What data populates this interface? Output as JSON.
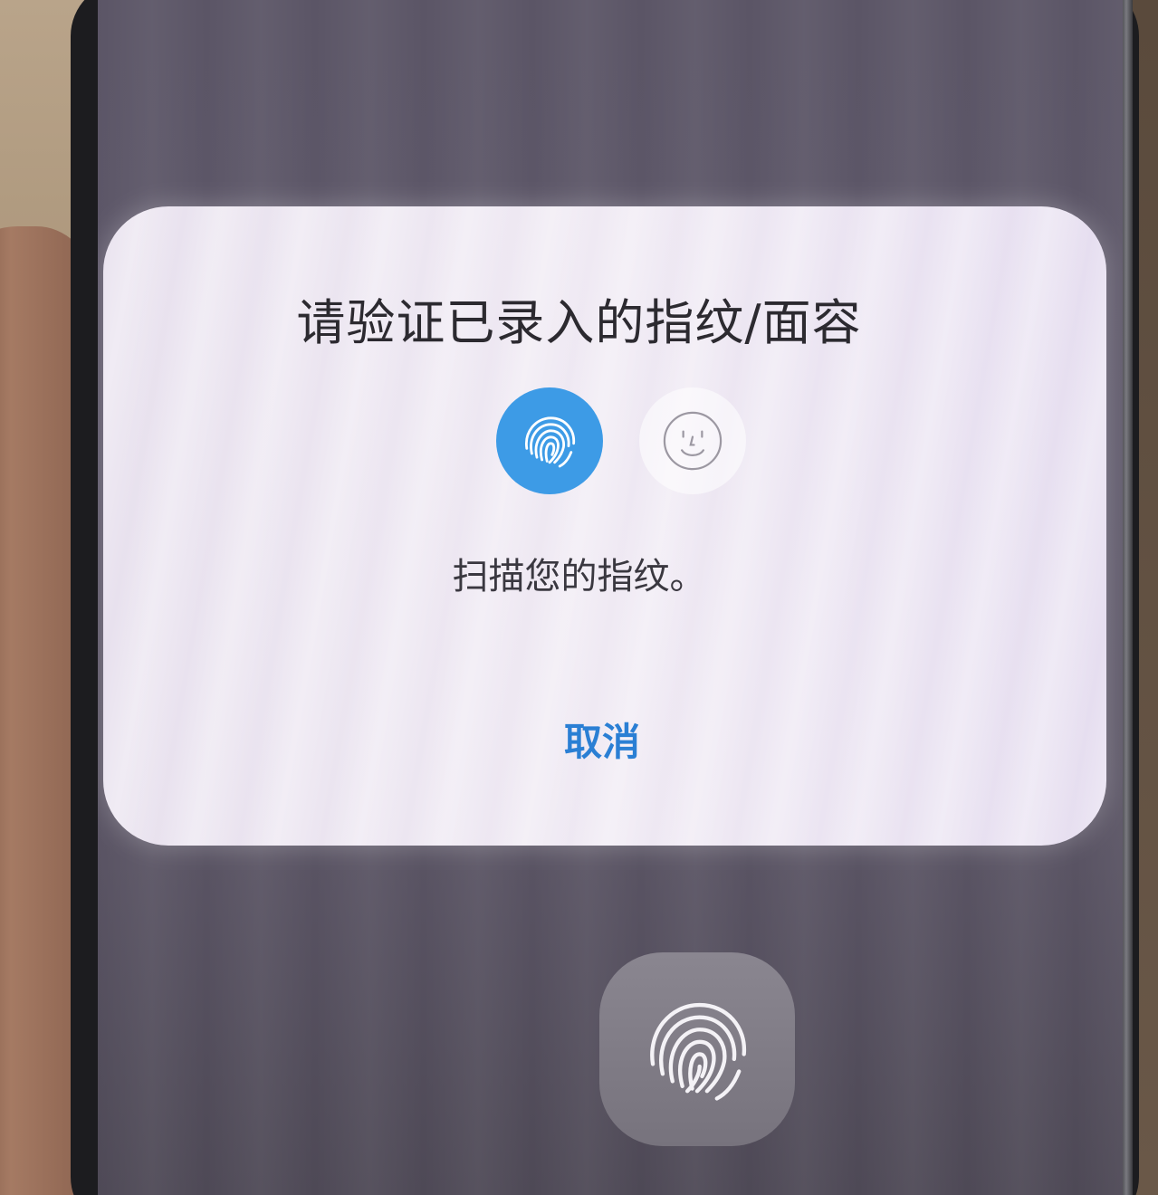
{
  "dialog": {
    "title": "请验证已录入的指纹/面容",
    "status": "扫描您的指纹。",
    "cancel_label": "取消",
    "auth_methods": [
      {
        "name": "fingerprint-icon",
        "selected": true,
        "color": "#3d9be6"
      },
      {
        "name": "face-icon",
        "selected": false
      }
    ]
  },
  "sensor": {
    "icon": "fingerprint-icon"
  },
  "colors": {
    "accent": "#2a7fd4",
    "selected_method_bg": "#3d9be6",
    "dialog_bg": "#ece6f2"
  }
}
